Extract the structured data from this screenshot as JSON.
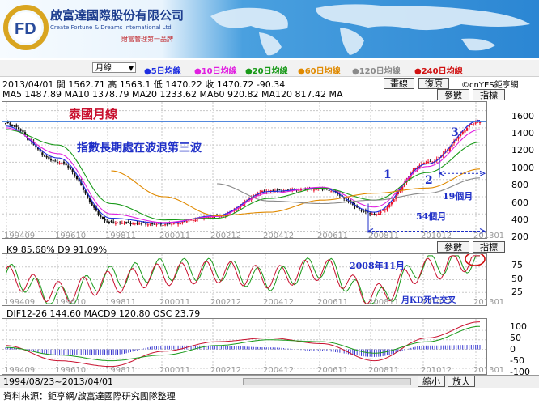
{
  "header": {
    "logo_text": "FD",
    "company_cn": "啟富達國際股份有限公司",
    "company_en": "Create Fortune & Dreams International Ltd",
    "slogan": "財富管理第一品牌"
  },
  "toolbar": {
    "period_select": "月線",
    "ma_labels": [
      {
        "text": "●5日均線",
        "color": "#1f2fe0"
      },
      {
        "text": "●10日均線",
        "color": "#e020e0"
      },
      {
        "text": "●20日均線",
        "color": "#1a9a1a"
      },
      {
        "text": "●60日均線",
        "color": "#e08a00"
      },
      {
        "text": "●120日均線",
        "color": "#8a8a8a"
      },
      {
        "text": "●240日均線",
        "color": "#d01010"
      }
    ]
  },
  "stats": {
    "line1": "2013/04/01 開 1562.71 高 1563.1 低 1470.22 收 1470.72 -90.34",
    "line2": "MA5 1487.89  MA10 1378.79  MA20 1233.62  MA60 920.82  MA120 817.42  MA",
    "copyright": "©cnYES鉅亨網"
  },
  "buttons": {
    "draw": "畫線",
    "restore": "復原",
    "params": "參數",
    "indicator": "指標",
    "zoom_out": "縮小",
    "zoom_in": "放大"
  },
  "main_chart": {
    "title": "泰國月線",
    "subtitle": "指數長期處在波浪第三波",
    "wave1": "1",
    "wave2": "2",
    "wave3": "3",
    "months19": "19個月",
    "months54": "54個月",
    "y_ticks": [
      "1600",
      "1400",
      "1200",
      "1000",
      "800",
      "600",
      "400",
      "200"
    ],
    "x_labels": [
      "199409",
      "199610",
      "199811",
      "200011",
      "200212",
      "200412",
      "200611",
      "200811",
      "201012",
      "201301"
    ]
  },
  "kd_panel": {
    "header": "K9 85.68%   D9 91.09%",
    "note_2008": "2008年11月",
    "note_death": "月KD死亡交叉",
    "y_ticks": [
      "75",
      "50",
      "25"
    ],
    "x_labels": [
      "199409",
      "199610",
      "199811",
      "200011",
      "200212",
      "200412",
      "200611",
      "200811",
      "201012",
      "201301"
    ]
  },
  "macd_panel": {
    "header": "DIF12-26 144.60   MACD9 120.80   OSC 23.79",
    "y_ticks": [
      "100",
      "50",
      "0",
      "-50",
      "-100"
    ],
    "x_labels": [
      "199409",
      "199610",
      "199811",
      "200011",
      "200212",
      "200412",
      "200611",
      "200811",
      "201012",
      "201301"
    ]
  },
  "footer": {
    "range": "1994/08/23~2013/04/01",
    "source": "資料來源：鉅亨網/啟富達國際研究團隊整理"
  },
  "chart_data": [
    {
      "type": "candlestick",
      "title": "泰國月線",
      "x": [
        "199409",
        "199610",
        "199811",
        "200011",
        "200212",
        "200412",
        "200611",
        "200811",
        "201012",
        "201301"
      ],
      "close": [
        1450,
        1000,
        300,
        280,
        370,
        670,
        690,
        400,
        1000,
        1470
      ],
      "series": [
        {
          "name": "5日均線",
          "values": [
            1420,
            1050,
            350,
            290,
            380,
            660,
            700,
            420,
            980,
            1487.89
          ]
        },
        {
          "name": "10日均線",
          "values": [
            1400,
            1100,
            400,
            300,
            370,
            640,
            710,
            480,
            950,
            1378.79
          ]
        },
        {
          "name": "20日均線",
          "values": [
            1380,
            1200,
            520,
            330,
            350,
            580,
            700,
            560,
            880,
            1233.62
          ]
        },
        {
          "name": "60日均線",
          "values": [
            null,
            null,
            900,
            600,
            380,
            420,
            560,
            640,
            700,
            920.82
          ]
        },
        {
          "name": "120日均線",
          "values": [
            null,
            null,
            null,
            null,
            750,
            550,
            520,
            560,
            640,
            817.42
          ]
        }
      ],
      "last": {
        "open": 1562.71,
        "high": 1563.1,
        "low": 1470.22,
        "close": 1470.72,
        "change": -90.34
      },
      "ylim": [
        120,
        1700
      ]
    },
    {
      "type": "line",
      "title": "K9 85.68%   D9 91.09%",
      "x": [
        "199409",
        "199610",
        "199811",
        "200011",
        "200212",
        "200412",
        "200611",
        "200811",
        "201012",
        "201301"
      ],
      "series": [
        {
          "name": "K9",
          "values": [
            60,
            15,
            55,
            70,
            70,
            50,
            75,
            10,
            80,
            85.68
          ]
        },
        {
          "name": "D9",
          "values": [
            55,
            25,
            45,
            60,
            65,
            55,
            70,
            20,
            70,
            91.09
          ]
        }
      ],
      "ylim": [
        0,
        100
      ]
    },
    {
      "type": "line",
      "title": "DIF12-26 144.60   MACD9 120.80   OSC 23.79",
      "x": [
        "199409",
        "199610",
        "199811",
        "200011",
        "200212",
        "200412",
        "200611",
        "200811",
        "201012",
        "201301"
      ],
      "series": [
        {
          "name": "DIF12-26",
          "values": [
            20,
            -60,
            -90,
            -10,
            40,
            60,
            30,
            -60,
            60,
            144.6
          ]
        },
        {
          "name": "MACD9",
          "values": [
            10,
            -30,
            -60,
            -30,
            20,
            50,
            40,
            -20,
            40,
            120.8
          ]
        },
        {
          "name": "OSC",
          "values": [
            10,
            -30,
            -30,
            20,
            20,
            10,
            -10,
            -40,
            20,
            23.79
          ]
        }
      ],
      "ylim": [
        -130,
        160
      ]
    }
  ]
}
